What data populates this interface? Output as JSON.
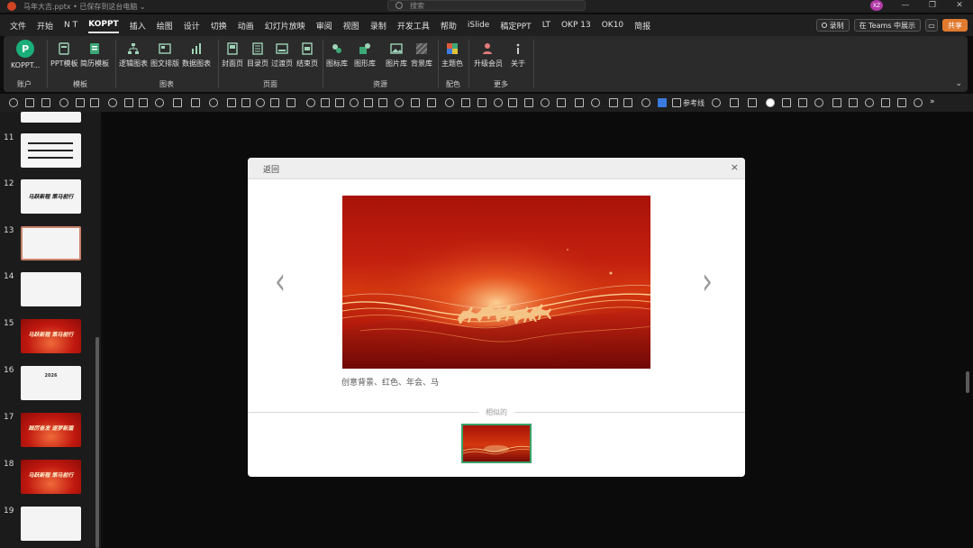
{
  "titlebar": {
    "doc_title": "马年大吉.pptx • 已保存到这台电脑 ⌄",
    "search_placeholder": "搜索",
    "user_initials": "XZ",
    "minimize": "—",
    "restore": "❐",
    "close": "✕"
  },
  "menu": {
    "tabs": [
      "文件",
      "开始",
      "N T",
      "KOPPT",
      "插入",
      "绘图",
      "设计",
      "切换",
      "动画",
      "幻灯片放映",
      "审阅",
      "视图",
      "录制",
      "开发工具",
      "帮助",
      "iSlide",
      "稿定PPT",
      "LT",
      "OKP 13",
      "OK10",
      "简报"
    ],
    "active_tab": "KOPPT",
    "record_label": "录制",
    "teams_label": "在 Teams 中展示",
    "share_label": "共享"
  },
  "ribbon": {
    "groups": {
      "account": {
        "label": "账户",
        "buttons": [
          "KOPPT..."
        ]
      },
      "template": {
        "label": "模板",
        "buttons": [
          "PPT模板",
          "简历模板"
        ]
      },
      "chart": {
        "label": "图表",
        "buttons": [
          "逻辑图表",
          "图文排版",
          "数据图表"
        ]
      },
      "page": {
        "label": "页面",
        "buttons": [
          "封面页",
          "目录页",
          "过渡页",
          "结束页"
        ]
      },
      "resource": {
        "label": "资源",
        "buttons": [
          "图标库",
          "图形库",
          "图片库",
          "背景库"
        ]
      },
      "color": {
        "label": "配色",
        "buttons": [
          "主题色"
        ]
      },
      "more": {
        "label": "更多",
        "buttons": [
          "升级会员",
          "关于"
        ]
      }
    },
    "logo_letter": "P"
  },
  "toolstrip": {
    "reference_line_label": "参考线"
  },
  "slides": [
    {
      "number": "11",
      "style": "white",
      "text": ""
    },
    {
      "number": "12",
      "style": "white",
      "text": "马跃新程 策马前行"
    },
    {
      "number": "13",
      "style": "white",
      "text": ""
    },
    {
      "number": "14",
      "style": "white",
      "text": ""
    },
    {
      "number": "15",
      "style": "red",
      "text": "马跃新程 策马前行"
    },
    {
      "number": "16",
      "style": "white",
      "text": "2026"
    },
    {
      "number": "17",
      "style": "red",
      "text": "踔厉奋发 逐梦新篇"
    },
    {
      "number": "18",
      "style": "red",
      "text": "马跃新程 策马前行"
    },
    {
      "number": "19",
      "style": "white",
      "text": ""
    }
  ],
  "selected_slide": "13",
  "modal": {
    "back_label": "返回",
    "close_label": "×",
    "prev_arrow": "‹",
    "next_arrow": "›",
    "caption": "创意背景、红色、年会、马",
    "related_label": "相似的"
  },
  "colors": {
    "accent_green": "#1aae7a",
    "share_orange": "#e07a2e",
    "preview_red": "#c4200f",
    "selected_border": "#3aa06a"
  }
}
